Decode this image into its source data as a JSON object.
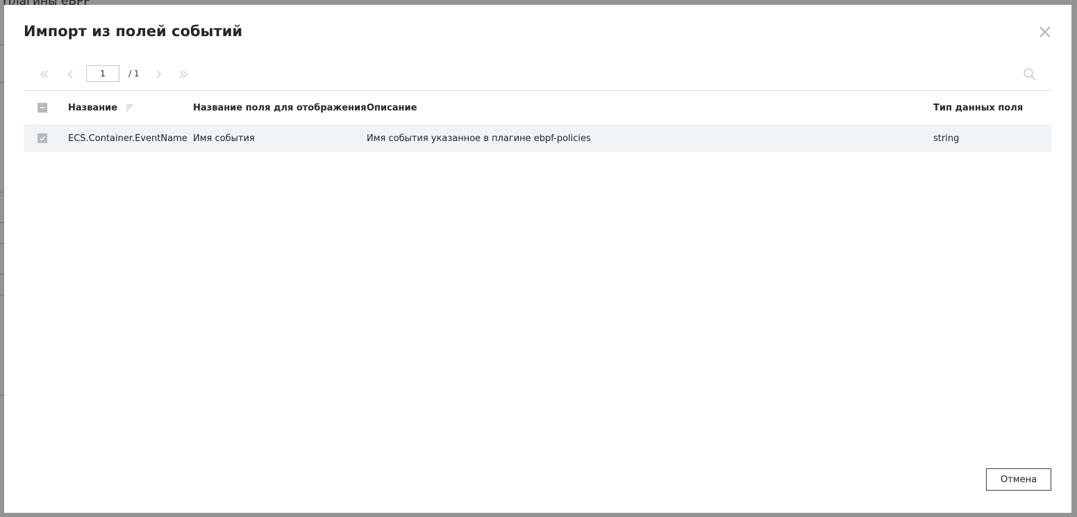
{
  "background": {
    "title": "Плагины eBPF"
  },
  "modal": {
    "title": "Импорт из полей событий",
    "close_icon": "close-icon",
    "pagination": {
      "current_page": "1",
      "total_label": "/ 1",
      "icons": [
        "first-page-icon",
        "prev-page-icon",
        "next-page-icon",
        "last-page-icon"
      ]
    },
    "search_icon": "search-icon",
    "table": {
      "columns": [
        {
          "label": "Название",
          "sortable": true
        },
        {
          "label": "Название поля для отображения"
        },
        {
          "label": "Описание"
        },
        {
          "label": "Тип данных поля"
        }
      ],
      "rows": [
        {
          "checked": true,
          "name": "ECS.Container.EventName",
          "display_name": "Имя события",
          "description": "Имя события указанное в плагине ebpf-policies",
          "data_type": "string"
        }
      ]
    },
    "cancel_label": "Отмена"
  },
  "colors": {
    "overlay": "#6b6b6b",
    "row_highlight": "#f1f4f7",
    "checkbox": "#b8b8b8",
    "icon_muted": "#c4c4c4"
  }
}
